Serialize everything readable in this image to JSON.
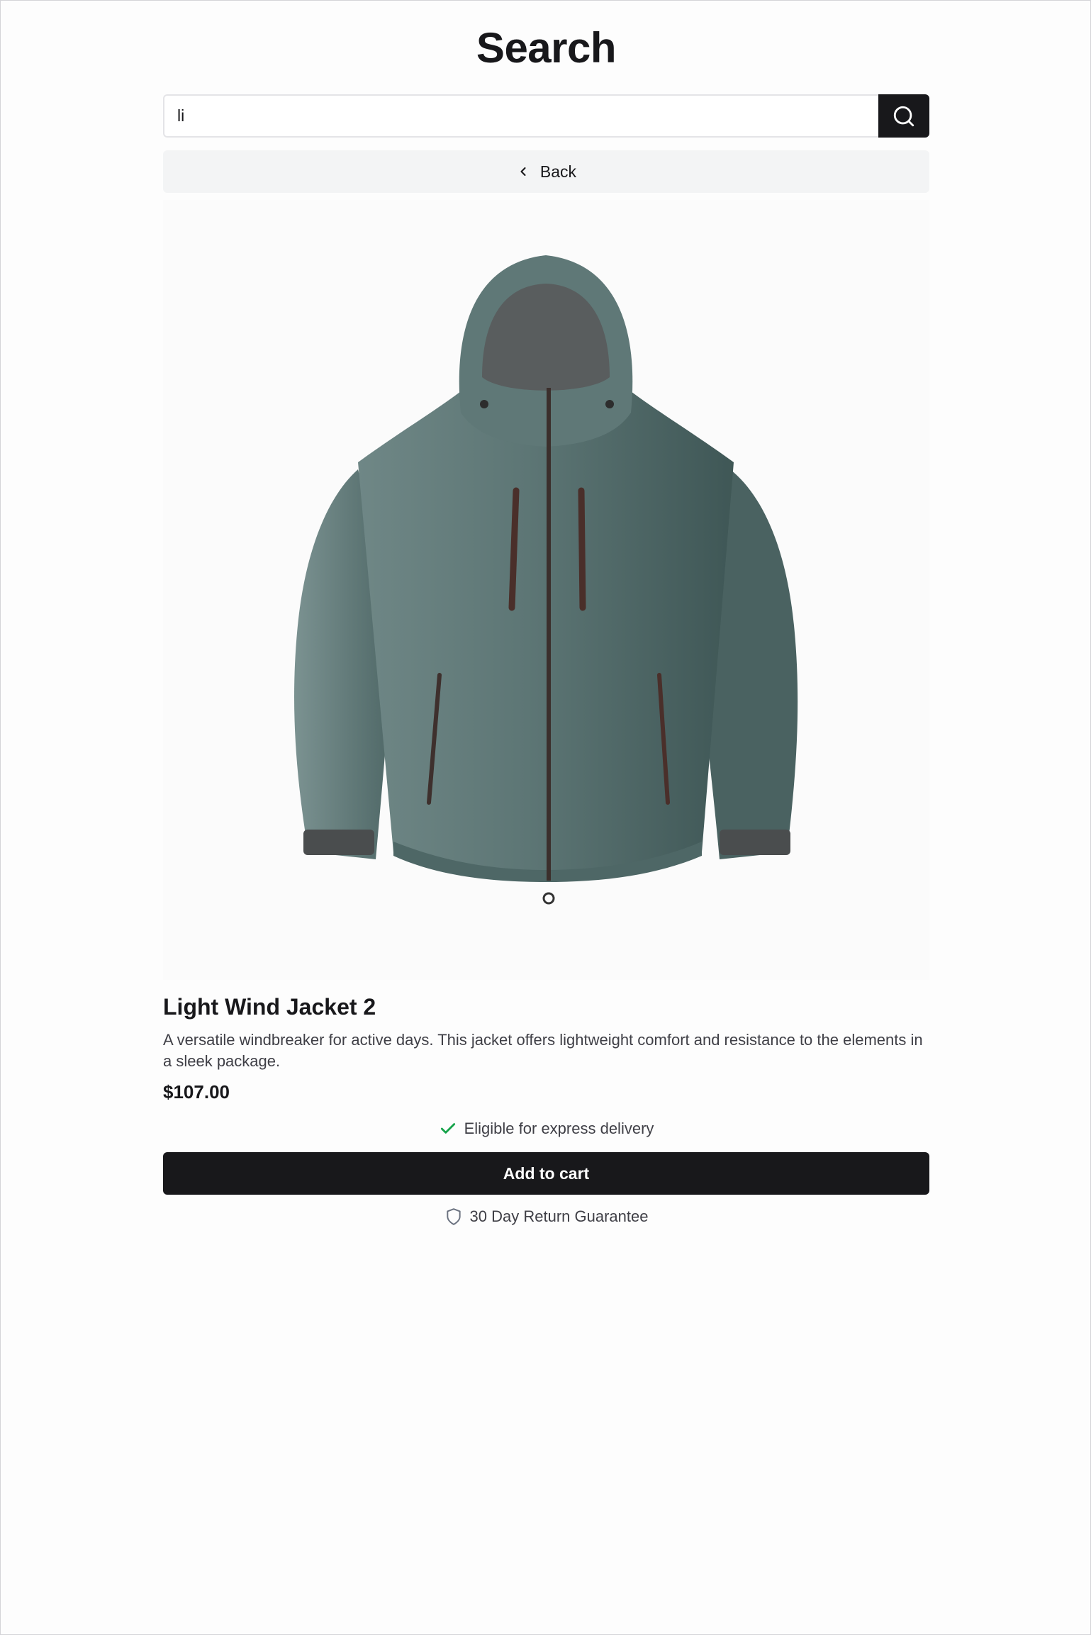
{
  "header": {
    "title": "Search"
  },
  "search": {
    "value": "li",
    "button_icon": "search-icon"
  },
  "nav": {
    "back_label": "Back",
    "back_icon": "chevron-left-icon"
  },
  "product": {
    "image_subject": "jacket",
    "name": "Light Wind Jacket 2",
    "description": "A versatile windbreaker for active days. This jacket offers lightweight comfort and resistance to the elements in a sleek package.",
    "price": "$107.00",
    "delivery_text": "Eligible for express delivery",
    "delivery_icon": "check-icon",
    "add_to_cart_label": "Add to cart",
    "guarantee_text": "30 Day Return Guarantee",
    "guarantee_icon": "shield-icon"
  },
  "colors": {
    "primary": "#18181b",
    "secondary_bg": "#f3f4f5",
    "check_green": "#16a34a",
    "jacket": "#56706f"
  }
}
